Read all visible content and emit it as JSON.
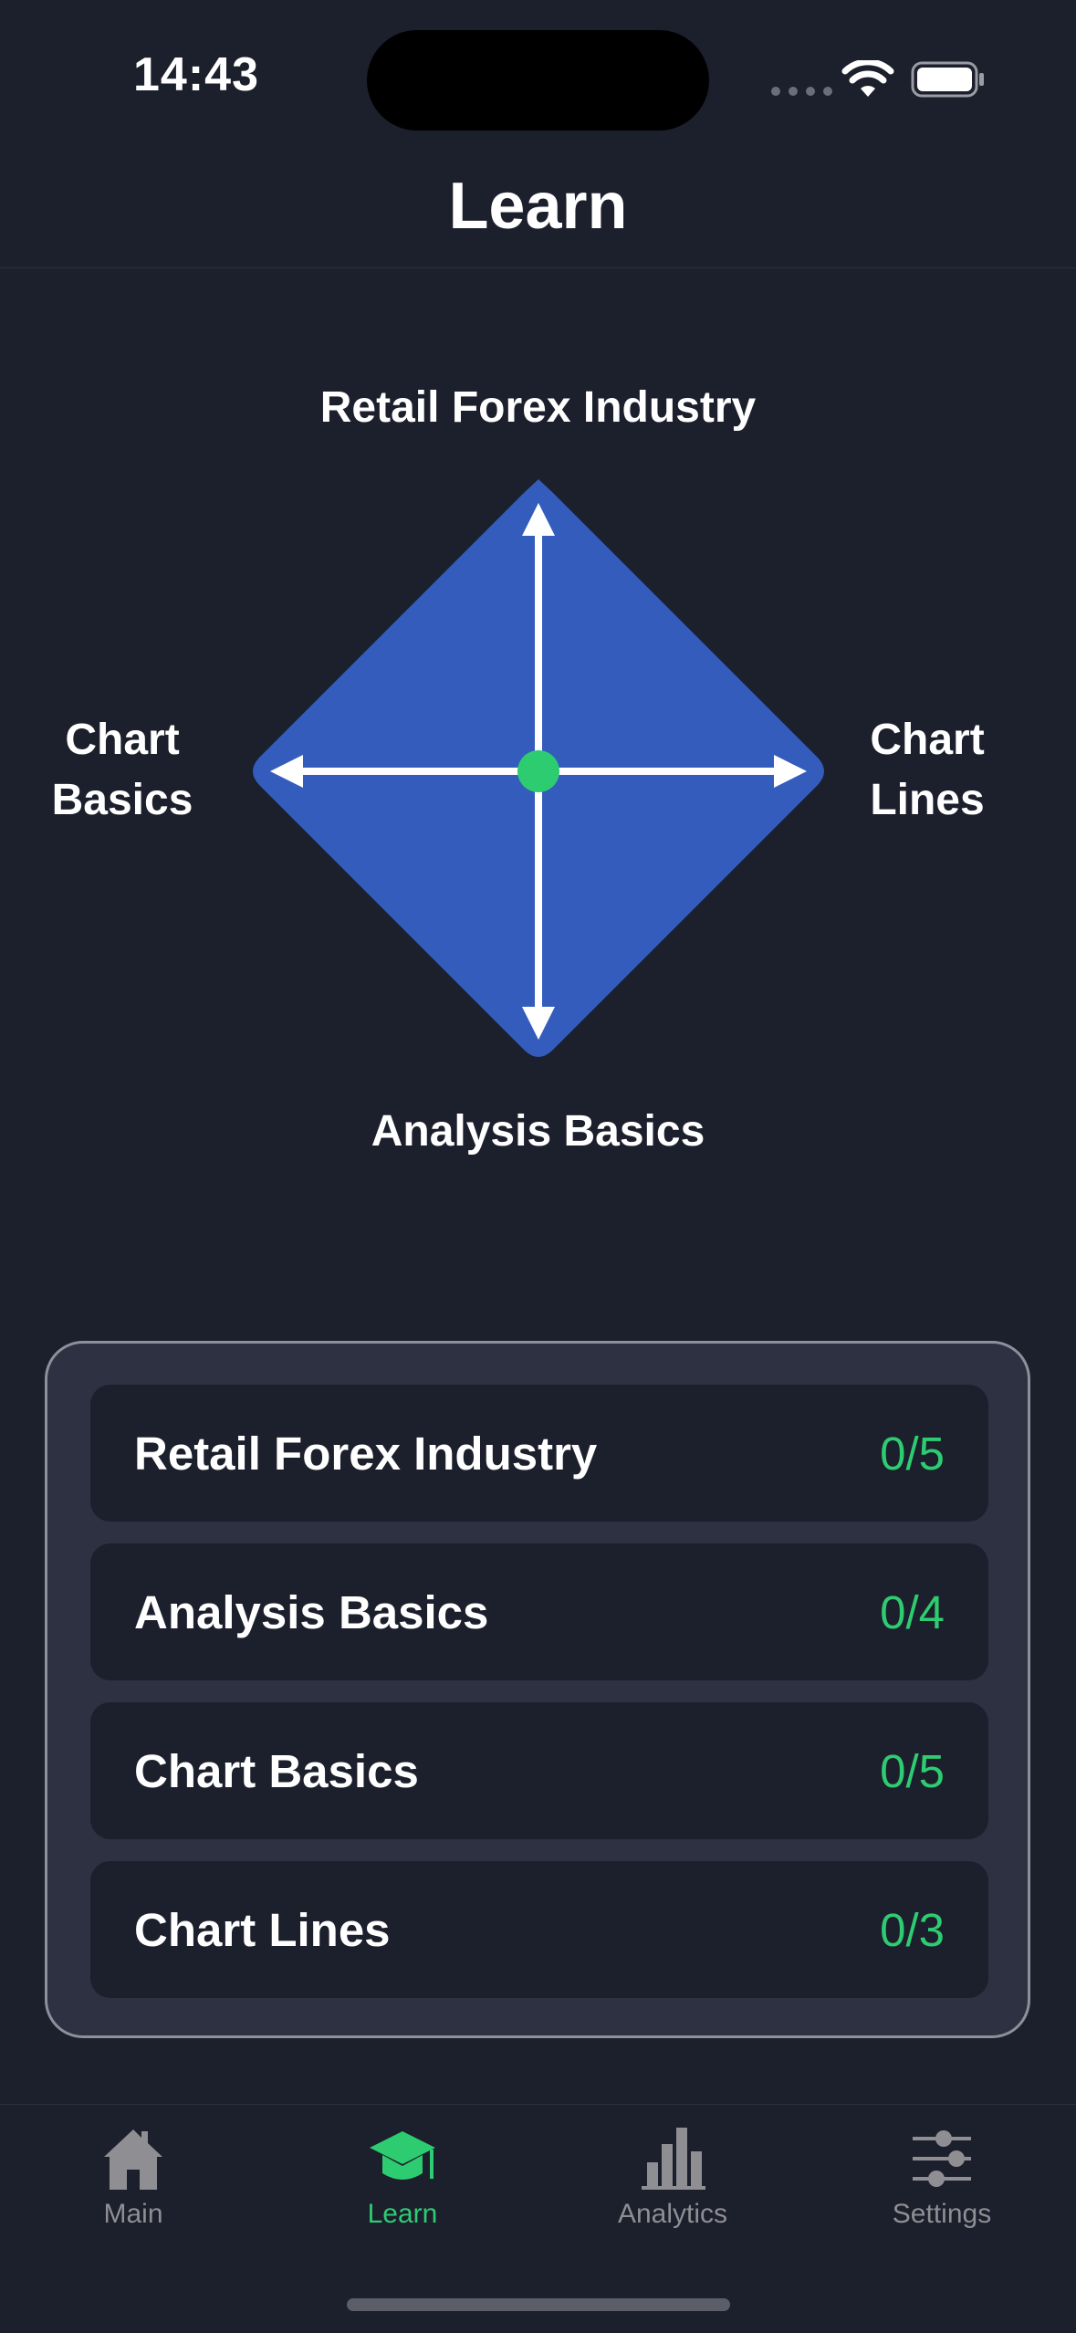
{
  "status_bar": {
    "time": "14:43"
  },
  "nav": {
    "title": "Learn"
  },
  "diagram": {
    "top_label": "Retail Forex Industry",
    "bottom_label": "Analysis Basics",
    "left_label": "Chart\nBasics",
    "right_label": "Chart\nLines",
    "colors": {
      "diamond": "#335cbd",
      "center_dot": "#2ecc71",
      "arrows": "#ffffff"
    }
  },
  "topics": [
    {
      "name": "Retail Forex Industry",
      "progress": "0/5"
    },
    {
      "name": "Analysis Basics",
      "progress": "0/4"
    },
    {
      "name": "Chart Basics",
      "progress": "0/5"
    },
    {
      "name": "Chart Lines",
      "progress": "0/3"
    }
  ],
  "tab_bar": {
    "active": "Learn",
    "items": [
      {
        "label": "Main",
        "icon": "house-icon"
      },
      {
        "label": "Learn",
        "icon": "graduation-cap-icon"
      },
      {
        "label": "Analytics",
        "icon": "bar-chart-icon"
      },
      {
        "label": "Settings",
        "icon": "sliders-icon"
      }
    ]
  },
  "colors": {
    "background": "#1c1f2c",
    "card": "#2d3141",
    "accent": "#2ecc71",
    "inactive_tab": "#8e8e93"
  }
}
